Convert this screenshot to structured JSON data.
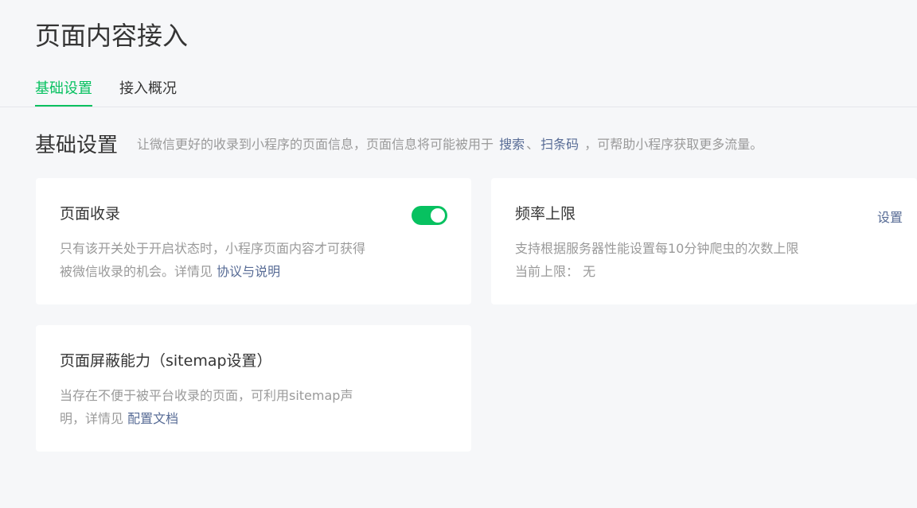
{
  "page": {
    "title": "页面内容接入"
  },
  "tabs": [
    {
      "label": "基础设置",
      "active": true
    },
    {
      "label": "接入概况",
      "active": false
    }
  ],
  "section": {
    "title": "基础设置",
    "desc_prefix": "让微信更好的收录到小程序的页面信息，页面信息将可能被用于",
    "link_search": "搜索",
    "separator": "、",
    "link_scan": "扫条码",
    "desc_suffix": "，可帮助小程序获取更多流量。"
  },
  "cards": {
    "indexing": {
      "title": "页面收录",
      "toggle_on": true,
      "desc_line1": "只有该开关处于开启状态时，小程序页面内容才可获得",
      "desc_line2_prefix": "被微信收录的机会。详情见",
      "link": "协议与说明"
    },
    "frequency": {
      "title": "频率上限",
      "action": "设置",
      "desc_line1": "支持根据服务器性能设置每10分钟爬虫的次数上限",
      "limit_label": "当前上限：",
      "limit_value": "无"
    },
    "sitemap": {
      "title": "页面屏蔽能力（sitemap设置）",
      "desc_line1": "当存在不便于被平台收录的页面，可利用sitemap声",
      "desc_line2_prefix": "明，详情见",
      "link": "配置文档"
    }
  },
  "colors": {
    "accent": "#07c160",
    "link": "#576b95",
    "muted": "#9a9a9a",
    "background": "#f6f7f9"
  }
}
